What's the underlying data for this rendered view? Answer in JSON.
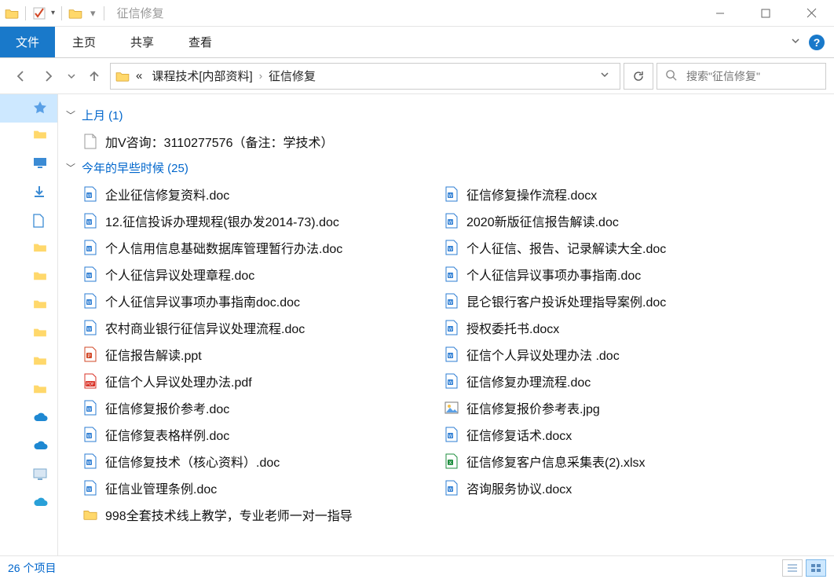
{
  "titlebar": {
    "title": "征信修复"
  },
  "ribbon": {
    "file": "文件",
    "tabs": [
      "主页",
      "共享",
      "查看"
    ]
  },
  "nav": {
    "crumb_prefix": "«",
    "crumbs": [
      "课程技术[内部资料]",
      "征信修复"
    ],
    "search_placeholder": "搜索\"征信修复\""
  },
  "groups": [
    {
      "label": "上月 (1)",
      "layout": "single",
      "items": [
        {
          "name": "加V咨询：3110277576（备注：学技术）",
          "type": "txt"
        }
      ]
    },
    {
      "label": "今年的早些时候 (25)",
      "layout": "double",
      "rows": 13,
      "items": [
        {
          "name": "企业征信修复资料.doc",
          "type": "doc"
        },
        {
          "name": "12.征信投诉办理规程(银办发2014-73).doc",
          "type": "doc"
        },
        {
          "name": "个人信用信息基础数据库管理暂行办法.doc",
          "type": "doc"
        },
        {
          "name": "个人征信异议处理章程.doc",
          "type": "doc"
        },
        {
          "name": "个人征信异议事项办事指南doc.doc",
          "type": "doc"
        },
        {
          "name": "农村商业银行征信异议处理流程.doc",
          "type": "doc"
        },
        {
          "name": "征信报告解读.ppt",
          "type": "ppt"
        },
        {
          "name": "征信个人异议处理办法.pdf",
          "type": "pdf"
        },
        {
          "name": "征信修复报价参考.doc",
          "type": "doc"
        },
        {
          "name": "征信修复表格样例.doc",
          "type": "doc"
        },
        {
          "name": "征信修复技术（核心资料）.doc",
          "type": "doc"
        },
        {
          "name": "征信业管理条例.doc",
          "type": "doc"
        },
        {
          "name": "998全套技术线上教学，专业老师一对一指导",
          "type": "folder"
        },
        {
          "name": "征信修复操作流程.docx",
          "type": "doc"
        },
        {
          "name": "2020新版征信报告解读.doc",
          "type": "doc"
        },
        {
          "name": "个人征信、报告、记录解读大全.doc",
          "type": "doc"
        },
        {
          "name": "个人征信异议事项办事指南.doc",
          "type": "doc"
        },
        {
          "name": "昆仑银行客户投诉处理指导案例.doc",
          "type": "doc"
        },
        {
          "name": "授权委托书.docx",
          "type": "doc"
        },
        {
          "name": "征信个人异议处理办法 .doc",
          "type": "doc"
        },
        {
          "name": "征信修复办理流程.doc",
          "type": "doc"
        },
        {
          "name": "征信修复报价参考表.jpg",
          "type": "jpg"
        },
        {
          "name": "征信修复话术.docx",
          "type": "doc"
        },
        {
          "name": "征信修复客户信息采集表(2).xlsx",
          "type": "xlsx"
        },
        {
          "name": "咨询服务协议.docx",
          "type": "doc"
        }
      ]
    }
  ],
  "status": {
    "count_text": "26 个项目"
  }
}
